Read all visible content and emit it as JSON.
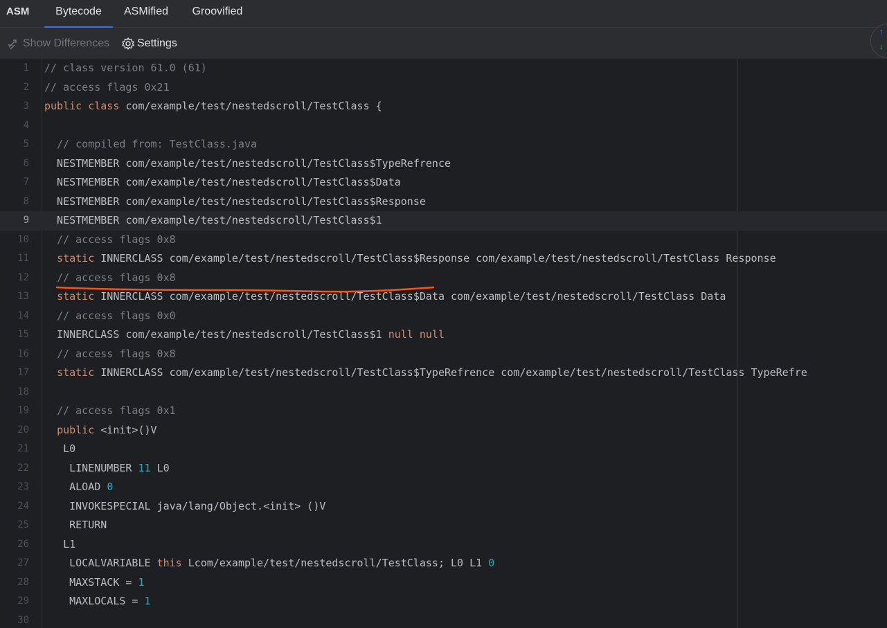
{
  "brand": "ASM",
  "tabs": [
    {
      "label": "Bytecode",
      "active": true
    },
    {
      "label": "ASMified",
      "active": false
    },
    {
      "label": "Groovified",
      "active": false
    }
  ],
  "toolbar": {
    "show_differences_label": "Show Differences",
    "settings_label": "Settings"
  },
  "colors": {
    "accent": "#3574f0",
    "keyword": "#cf8e6d",
    "comment": "#7a7e85",
    "number": "#2aacb8",
    "annotation": "#ff5500"
  },
  "editor": {
    "current_line": 9,
    "lines": [
      [
        {
          "t": "// class version 61.0 (61)",
          "c": "cmt"
        }
      ],
      [
        {
          "t": "// access flags 0x21",
          "c": "cmt"
        }
      ],
      [
        {
          "t": "public",
          "c": "kw"
        },
        {
          "t": " "
        },
        {
          "t": "class",
          "c": "kw"
        },
        {
          "t": " com/example/test/nestedscroll/TestClass {"
        }
      ],
      [],
      [
        {
          "t": "  "
        },
        {
          "t": "// compiled from: TestClass.java",
          "c": "cmt"
        }
      ],
      [
        {
          "t": "  NESTMEMBER com/example/test/nestedscroll/TestClass$TypeRefrence"
        }
      ],
      [
        {
          "t": "  NESTMEMBER com/example/test/nestedscroll/TestClass$Data"
        }
      ],
      [
        {
          "t": "  NESTMEMBER com/example/test/nestedscroll/TestClass$Response"
        }
      ],
      [
        {
          "t": "  NESTMEMBER com/example/test/nestedscroll/TestClass$1"
        }
      ],
      [
        {
          "t": "  "
        },
        {
          "t": "// access flags 0x8",
          "c": "cmt"
        }
      ],
      [
        {
          "t": "  "
        },
        {
          "t": "static",
          "c": "kw"
        },
        {
          "t": " INNERCLASS com/example/test/nestedscroll/TestClass$Response com/example/test/nestedscroll/TestClass Response"
        }
      ],
      [
        {
          "t": "  "
        },
        {
          "t": "// access flags 0x8",
          "c": "cmt"
        }
      ],
      [
        {
          "t": "  "
        },
        {
          "t": "static",
          "c": "kw"
        },
        {
          "t": " INNERCLASS com/example/test/nestedscroll/TestClass$Data com/example/test/nestedscroll/TestClass Data"
        }
      ],
      [
        {
          "t": "  "
        },
        {
          "t": "// access flags 0x0",
          "c": "cmt"
        }
      ],
      [
        {
          "t": "  INNERCLASS com/example/test/nestedscroll/TestClass$1 "
        },
        {
          "t": "null",
          "c": "kw"
        },
        {
          "t": " "
        },
        {
          "t": "null",
          "c": "kw"
        }
      ],
      [
        {
          "t": "  "
        },
        {
          "t": "// access flags 0x8",
          "c": "cmt"
        }
      ],
      [
        {
          "t": "  "
        },
        {
          "t": "static",
          "c": "kw"
        },
        {
          "t": " INNERCLASS com/example/test/nestedscroll/TestClass$TypeRefrence com/example/test/nestedscroll/TestClass TypeRefre"
        }
      ],
      [],
      [
        {
          "t": "  "
        },
        {
          "t": "// access flags 0x1",
          "c": "cmt"
        }
      ],
      [
        {
          "t": "  "
        },
        {
          "t": "public",
          "c": "kw"
        },
        {
          "t": " <init>()V"
        }
      ],
      [
        {
          "t": "   L0"
        }
      ],
      [
        {
          "t": "    LINENUMBER "
        },
        {
          "t": "11",
          "c": "num"
        },
        {
          "t": " L0"
        }
      ],
      [
        {
          "t": "    ALOAD "
        },
        {
          "t": "0",
          "c": "num"
        }
      ],
      [
        {
          "t": "    INVOKESPECIAL java/lang/Object.<init> ()V"
        }
      ],
      [
        {
          "t": "    RETURN"
        }
      ],
      [
        {
          "t": "   L1"
        }
      ],
      [
        {
          "t": "    LOCALVARIABLE "
        },
        {
          "t": "this",
          "c": "kw"
        },
        {
          "t": " Lcom/example/test/nestedscroll/TestClass; L0 L1 "
        },
        {
          "t": "0",
          "c": "num"
        }
      ],
      [
        {
          "t": "    MAXSTACK = "
        },
        {
          "t": "1",
          "c": "num"
        }
      ],
      [
        {
          "t": "    MAXLOCALS = "
        },
        {
          "t": "1",
          "c": "num"
        }
      ],
      []
    ]
  }
}
